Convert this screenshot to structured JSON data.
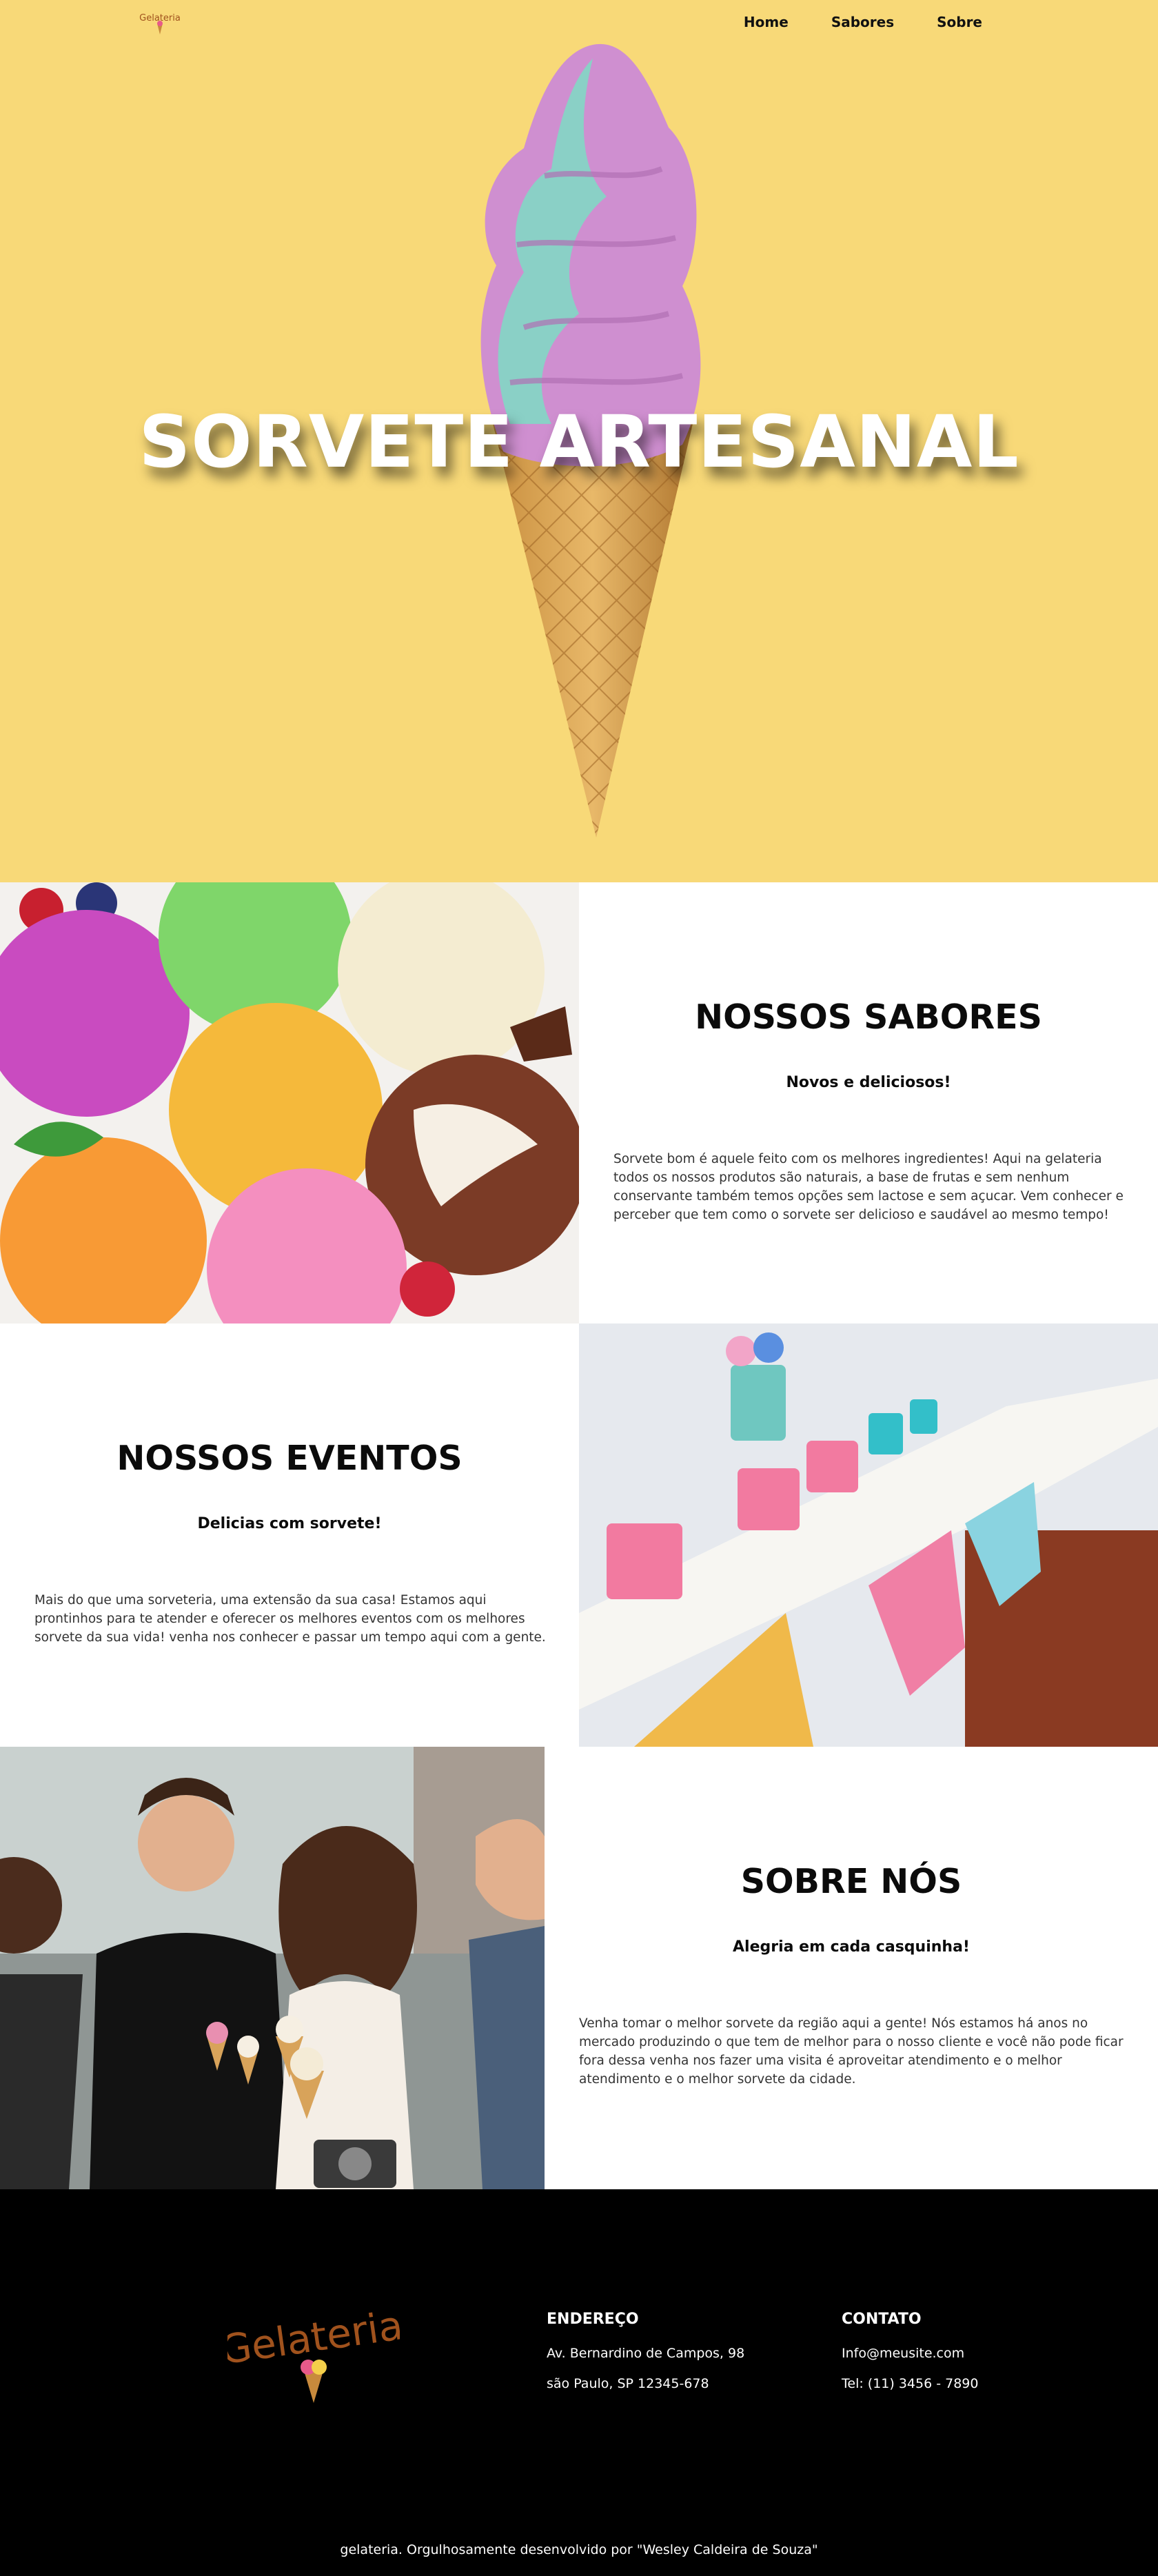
{
  "nav": {
    "logo_text": "Gelateria",
    "links": [
      "Home",
      "Sabores",
      "Sobre"
    ]
  },
  "hero": {
    "title": "SORVETE ARTESANAL"
  },
  "sections": {
    "sabores": {
      "title": "NOSSOS SABORES",
      "subtitle": "Novos e deliciosos!",
      "body": "Sorvete bom é aquele feito com os melhores ingredientes! Aqui na gelateria todos os nossos produtos são naturais, a base de frutas e sem nenhum conservante também temos opções sem lactose e sem açucar. Vem conhecer e perceber que tem como o sorvete ser delicioso e saudável ao mesmo tempo!"
    },
    "eventos": {
      "title": "NOSSOS EVENTOS",
      "subtitle": "Delicias com sorvete!",
      "body": "Mais do que uma sorveteria, uma extensão da sua casa! Estamos aqui prontinhos para te atender e oferecer os melhores eventos com os melhores sorvete da sua vida! venha nos conhecer e passar um tempo aqui com a gente."
    },
    "sobre": {
      "title": "SOBRE NÓS",
      "subtitle": "Alegria em cada casquinha!",
      "body": "Venha tomar o melhor sorvete da região aqui a gente! Nós estamos há anos no mercado produzindo o que tem de melhor para o nosso cliente e você não pode ficar fora dessa venha nos fazer uma visita é aproveitar atendimento e o melhor atendimento e o melhor sorvete da cidade."
    }
  },
  "footer": {
    "logo_text": "Gelateria",
    "address": {
      "heading": "ENDEREÇO",
      "line1": "Av. Bernardino de Campos, 98",
      "line2": "são Paulo, SP 12345-678"
    },
    "contact": {
      "heading": "CONTATO",
      "email": "Info@meusite.com",
      "phone": "Tel: (11) 3456 - 7890"
    },
    "credit": "gelateria. Orgulhosamente desenvolvido por \"Wesley Caldeira de Souza\""
  },
  "colors": {
    "hero_bg": "#f8d978",
    "footer_bg": "#000000",
    "logo_brown": "#a0521d"
  }
}
